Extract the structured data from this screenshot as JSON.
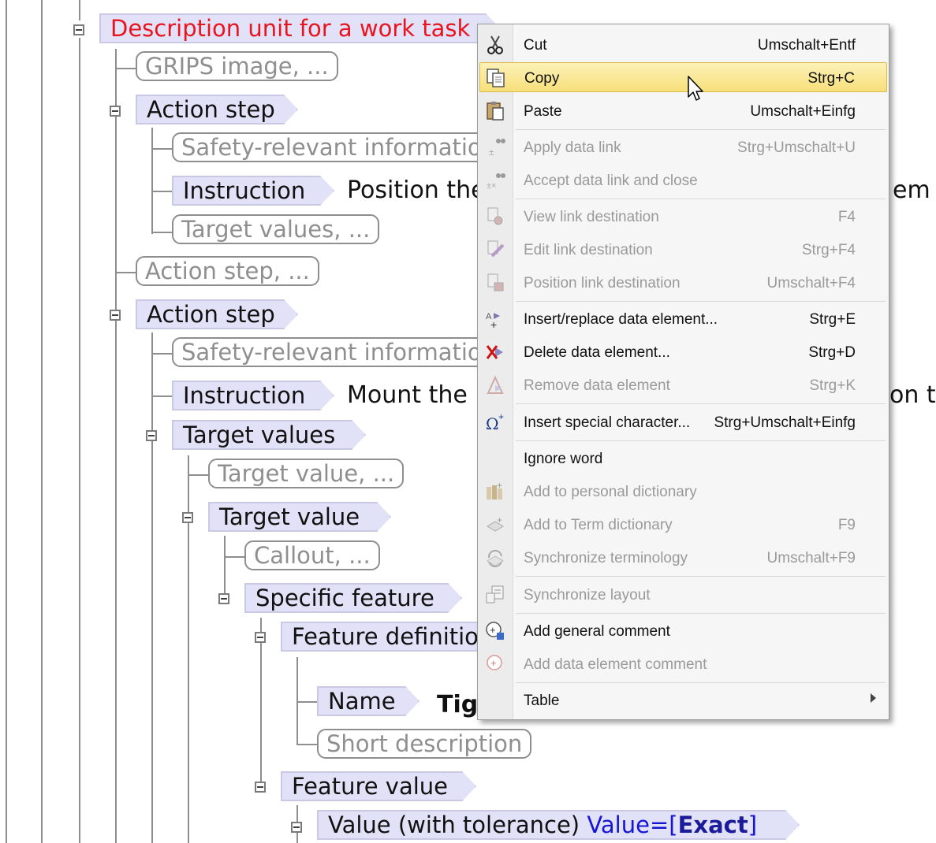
{
  "tree": {
    "root": "Description unit for a work task",
    "grips": "GRIPS image, ...",
    "action_step": "Action step",
    "safety": "Safety-relevant information, ...",
    "instruction": "Instruction",
    "instruction1_text": "Position the",
    "instruction1_tail": "em",
    "target_values_ph": "Target values, ...",
    "action_step_ph": "Action step, ...",
    "instruction2_text": "Mount the",
    "instruction2_tail": "on t",
    "target_values": "Target values",
    "target_value_ph": "Target value, ...",
    "target_value": "Target value",
    "callout_ph": "Callout, ...",
    "specific_feature": "Specific feature",
    "feature_definition": "Feature definition",
    "name": "Name",
    "name_text": "Tig",
    "short_description": "Short description",
    "feature_value": "Feature value",
    "value_tol": "Value (with tolerance)",
    "attr_label": "Value=",
    "attr_open": "[",
    "attr_value": "Exact",
    "attr_close": "]"
  },
  "menu": {
    "items": [
      {
        "label": "Cut",
        "shortcut": "Umschalt+Entf",
        "icon": "scissors-icon",
        "enabled": true
      },
      {
        "label": "Copy",
        "shortcut": "Strg+C",
        "icon": "copy-icon",
        "enabled": true,
        "highlighted": true
      },
      {
        "label": "Paste",
        "shortcut": "Umschalt+Einfg",
        "icon": "paste-icon",
        "enabled": true
      },
      {
        "label": "Apply data link",
        "shortcut": "Strg+Umschalt+U",
        "icon": "apply-link-icon",
        "enabled": false
      },
      {
        "label": "Accept data link and close",
        "shortcut": "",
        "icon": "accept-link-icon",
        "enabled": false
      },
      {
        "label": "View link destination",
        "shortcut": "F4",
        "icon": "view-link-icon",
        "enabled": false
      },
      {
        "label": "Edit link destination",
        "shortcut": "Strg+F4",
        "icon": "edit-link-icon",
        "enabled": false
      },
      {
        "label": "Position link destination",
        "shortcut": "Umschalt+F4",
        "icon": "position-link-icon",
        "enabled": false
      },
      {
        "label": "Insert/replace data element...",
        "shortcut": "Strg+E",
        "icon": "insert-element-icon",
        "enabled": true
      },
      {
        "label": "Delete data element...",
        "shortcut": "Strg+D",
        "icon": "delete-element-icon",
        "enabled": true
      },
      {
        "label": "Remove data element",
        "shortcut": "Strg+K",
        "icon": "remove-element-icon",
        "enabled": false
      },
      {
        "label": "Insert special character...",
        "shortcut": "Strg+Umschalt+Einfg",
        "icon": "omega-icon",
        "enabled": true
      },
      {
        "label": "Ignore word",
        "shortcut": "",
        "icon": "",
        "enabled": true
      },
      {
        "label": "Add to personal dictionary",
        "shortcut": "",
        "icon": "dictionary-icon",
        "enabled": false
      },
      {
        "label": "Add to Term dictionary",
        "shortcut": "F9",
        "icon": "term-dictionary-icon",
        "enabled": false
      },
      {
        "label": "Synchronize terminology",
        "shortcut": "Umschalt+F9",
        "icon": "sync-terminology-icon",
        "enabled": false
      },
      {
        "label": "Synchronize layout",
        "shortcut": "",
        "icon": "sync-layout-icon",
        "enabled": false
      },
      {
        "label": "Add general comment",
        "shortcut": "",
        "icon": "general-comment-icon",
        "enabled": true
      },
      {
        "label": "Add data element comment",
        "shortcut": "",
        "icon": "element-comment-icon",
        "enabled": false
      },
      {
        "label": "Table",
        "shortcut": "",
        "icon": "",
        "enabled": true,
        "submenu": true
      }
    ]
  },
  "colors": {
    "element_fill": "#e1e1f7",
    "root_text": "#e8141e",
    "attribute_blue": "#1515d6",
    "menu_highlight": "#f7df7a"
  }
}
